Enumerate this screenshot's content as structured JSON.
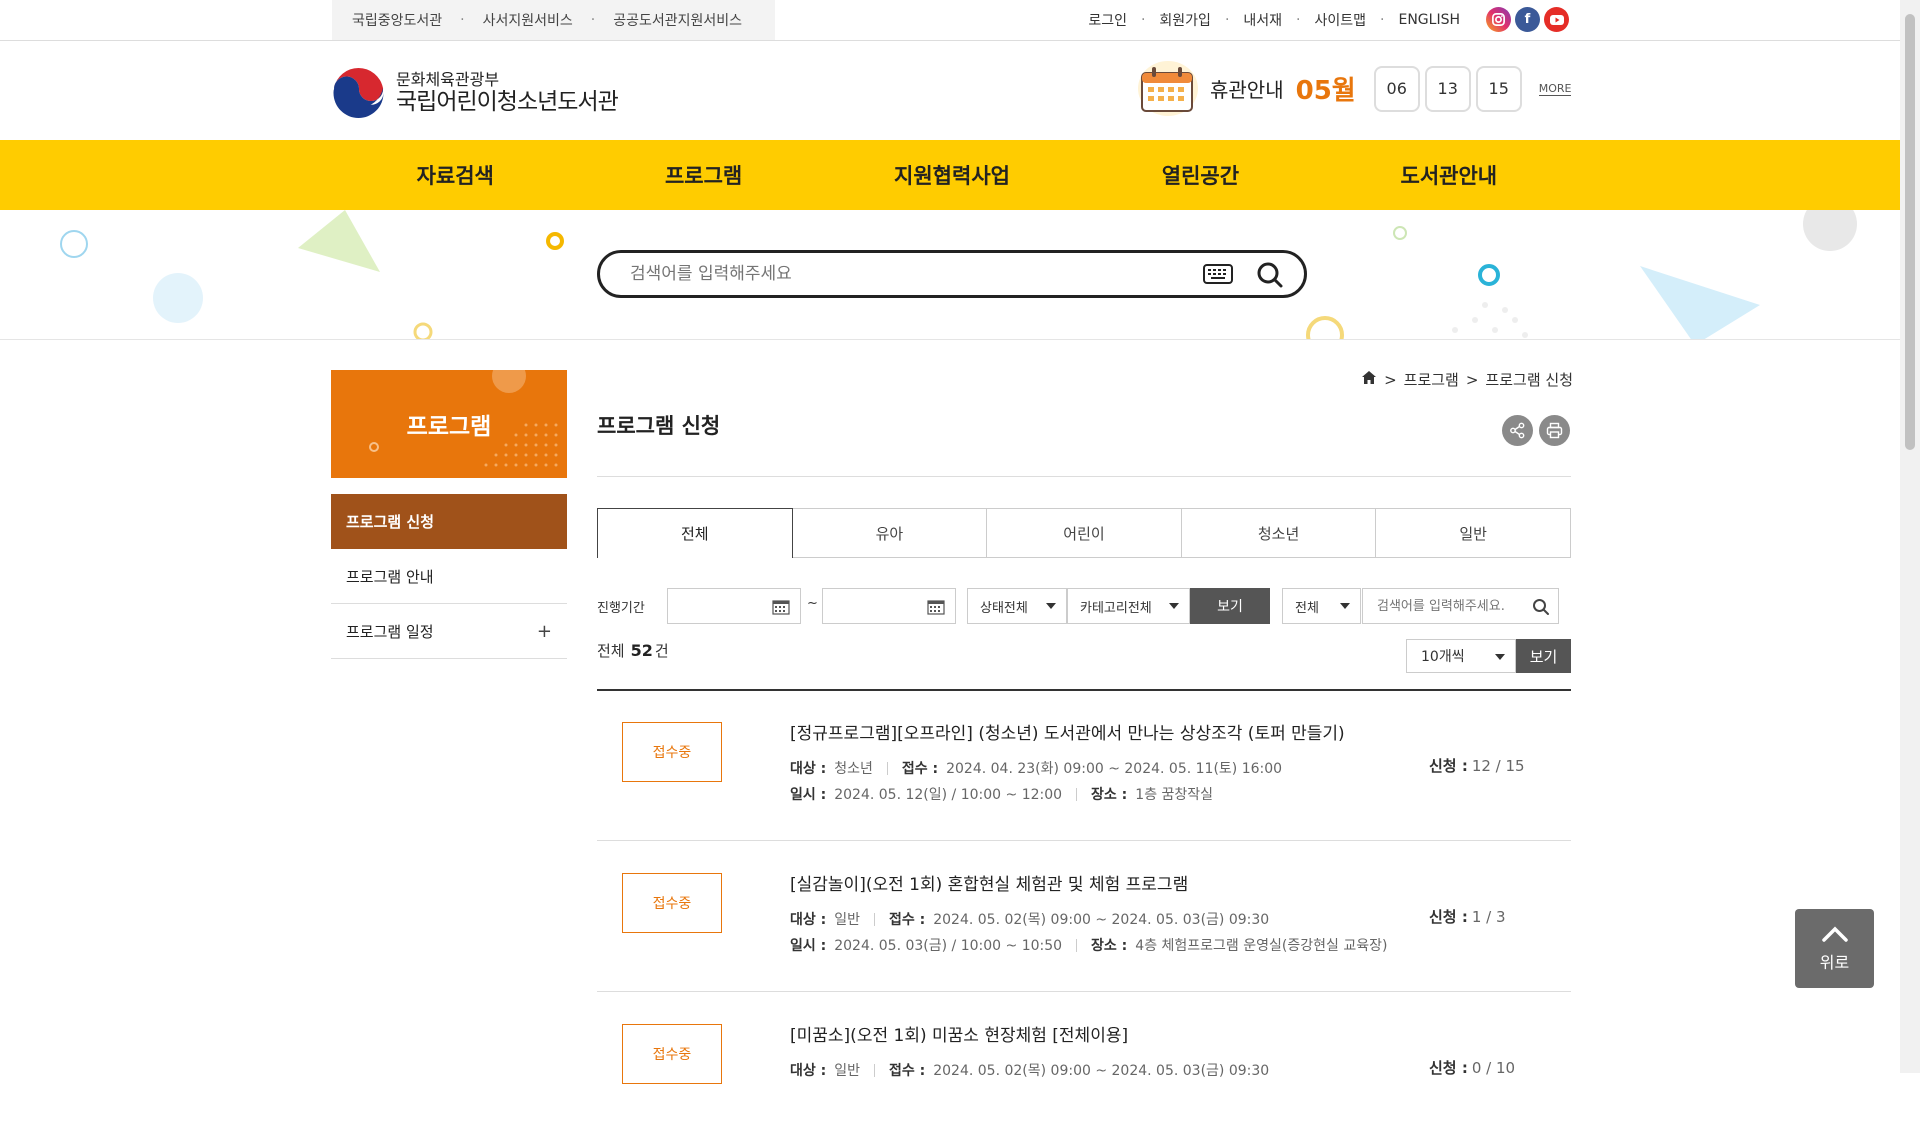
{
  "family_sites": [
    "국립중앙도서관",
    "사서지원서비스",
    "공공도서관지원서비스"
  ],
  "util_links": [
    "로그인",
    "회원가입",
    "내서재",
    "사이트맵",
    "ENGLISH"
  ],
  "logo": {
    "ministry": "문화체육관광부",
    "name": "국립어린이청소년도서관"
  },
  "holiday": {
    "label": "휴관안내",
    "month": "05월",
    "days": [
      "06",
      "13",
      "15"
    ],
    "more": "MORE"
  },
  "gnb": [
    "자료검색",
    "프로그램",
    "지원협력사업",
    "열린공간",
    "도서관안내"
  ],
  "search": {
    "placeholder": "검색어를 입력해주세요"
  },
  "lnb": {
    "title": "프로그램",
    "items": [
      "프로그램 신청",
      "프로그램 안내",
      "프로그램 일정"
    ],
    "plus": "+"
  },
  "breadcrumb": [
    "프로그램",
    "프로그램 신청"
  ],
  "page_title": "프로그램 신청",
  "tabs": [
    "전체",
    "유아",
    "어린이",
    "청소년",
    "일반"
  ],
  "filter": {
    "period_label": "진행기간",
    "tilde": "~",
    "status": "상태전체",
    "category": "카테고리전체",
    "view_btn": "보기",
    "scope": "전체",
    "keyword_placeholder": "검색어를 입력해주세요."
  },
  "total": {
    "prefix": "전체",
    "count": "52",
    "suffix": "건"
  },
  "per_page": {
    "value": "10개씩",
    "button": "보기"
  },
  "programs": [
    {
      "status": "접수중",
      "title": "[정규프로그램][오프라인] (청소년) 도서관에서 만나는 상상조각 (토퍼 만들기)",
      "target_label": "대상 :",
      "target": "청소년",
      "reception_label": "접수 :",
      "reception": "2024. 04. 23(화) 09:00 ~ 2024. 05. 11(토) 16:00",
      "date_label": "일시 :",
      "date": "2024. 05. 12(일) / 10:00 ~ 12:00",
      "place_label": "장소 :",
      "place": "1층 꿈창작실",
      "apply_label": "신청 :",
      "apply": "12 / 15"
    },
    {
      "status": "접수중",
      "title": "[실감놀이](오전 1회) 혼합현실 체험관 및 체험 프로그램",
      "target_label": "대상 :",
      "target": "일반",
      "reception_label": "접수 :",
      "reception": "2024. 05. 02(목) 09:00 ~ 2024. 05. 03(금) 09:30",
      "date_label": "일시 :",
      "date": "2024. 05. 03(금) / 10:00 ~ 10:50",
      "place_label": "장소 :",
      "place": "4층 체험프로그램 운영실(증강현실 교육장)",
      "apply_label": "신청 :",
      "apply": "1 / 3"
    },
    {
      "status": "접수중",
      "title": "[미꿈소](오전 1회) 미꿈소 현장체험 [전체이용]",
      "target_label": "대상 :",
      "target": "일반",
      "reception_label": "접수 :",
      "reception": "2024. 05. 02(목) 09:00 ~ 2024. 05. 03(금) 09:30",
      "date_label": "",
      "date": "",
      "place_label": "",
      "place": "",
      "apply_label": "신청 :",
      "apply": "0 / 10"
    }
  ],
  "top_button": "위로",
  "colors": {
    "gnb": "#ffcc00",
    "accent": "#e8760c",
    "lnb_active": "#a0521a"
  }
}
